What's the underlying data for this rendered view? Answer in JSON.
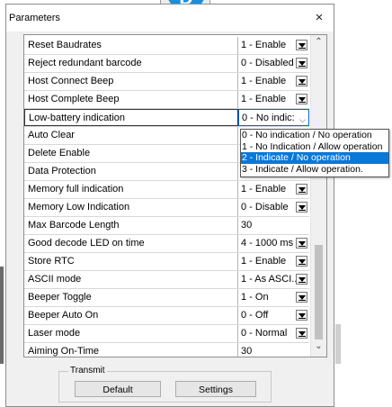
{
  "badge": "D",
  "dialog": {
    "title": "Parameters",
    "close_glyph": "×"
  },
  "rows": [
    {
      "name": "Reset Baudrates",
      "value": "1 - Enable",
      "dropdown": true
    },
    {
      "name": "Reject redundant barcode",
      "value": "0 - Disabled",
      "dropdown": true
    },
    {
      "name": "Host Connect Beep",
      "value": "1 - Enable",
      "dropdown": true
    },
    {
      "name": "Host Complete Beep",
      "value": "1 - Enable",
      "dropdown": true
    },
    {
      "name": "Low-battery indication",
      "value": "0 - No indic:",
      "dropdown": false,
      "focused": true
    },
    {
      "name": "Auto Clear",
      "value": "",
      "dropdown": false
    },
    {
      "name": "Delete Enable",
      "value": "",
      "dropdown": false
    },
    {
      "name": "Data Protection",
      "value": "",
      "dropdown": false
    },
    {
      "name": "Memory full indication",
      "value": "1 - Enable",
      "dropdown": true
    },
    {
      "name": "Memory Low Indication",
      "value": "0 - Disable",
      "dropdown": true
    },
    {
      "name": "Max Barcode Length",
      "value": "30",
      "dropdown": false
    },
    {
      "name": "Good decode LED on time",
      "value": "4 - 1000 ms",
      "dropdown": true
    },
    {
      "name": "Store RTC",
      "value": "1 - Enable",
      "dropdown": true
    },
    {
      "name": "ASCII mode",
      "value": "1 - As ASCI...",
      "dropdown": true
    },
    {
      "name": "Beeper Toggle",
      "value": "1 - On",
      "dropdown": true
    },
    {
      "name": "Beeper Auto On",
      "value": "0 - Off",
      "dropdown": true
    },
    {
      "name": "Laser mode",
      "value": "0 - Normal",
      "dropdown": true
    },
    {
      "name": "Aiming On-Time",
      "value": "30",
      "dropdown": false
    }
  ],
  "dropdown_options": [
    "0 - No indication / No operation",
    "1 - No Indication / Allow operation",
    "2 - Indicate / No operation",
    "3 - Indicate / Allow operation."
  ],
  "dropdown_highlighted": 2,
  "footer": {
    "group_label": "Transmit",
    "default_label": "Default",
    "settings_label": "Settings"
  },
  "icons": {
    "close": "close-icon",
    "chevron": "chevron-down-icon",
    "scroll_up": "scroll-up-icon",
    "scroll_down": "scroll-down-icon"
  },
  "colors": {
    "accent": "#0a78d7",
    "badge": "#1d8fd8",
    "dialog_bg": "#f0f0f0"
  }
}
